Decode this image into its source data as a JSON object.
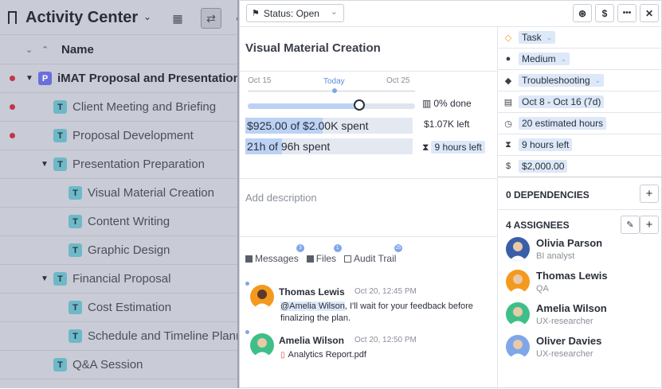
{
  "header": {
    "title": "Activity Center"
  },
  "tree": {
    "column_name": "Name",
    "rows": [
      {
        "badge": "P",
        "label": "iMAT Proposal and Presentation",
        "bold": true,
        "flag": true,
        "caret": true
      },
      {
        "badge": "T",
        "label": "Client Meeting and Briefing",
        "flag": true
      },
      {
        "badge": "T",
        "label": "Proposal Development",
        "flag": true
      },
      {
        "badge": "T",
        "label": "Presentation Preparation",
        "caret": true
      },
      {
        "badge": "T",
        "label": "Visual Material Creation"
      },
      {
        "badge": "T",
        "label": "Content Writing"
      },
      {
        "badge": "T",
        "label": "Graphic Design"
      },
      {
        "badge": "T",
        "label": "Financial Proposal",
        "caret": true
      },
      {
        "badge": "T",
        "label": "Cost Estimation"
      },
      {
        "badge": "T",
        "label": "Schedule and Timeline Planning"
      },
      {
        "badge": "T",
        "label": "Q&A Session"
      }
    ]
  },
  "panel": {
    "status_label": "Status: Open",
    "dollar_label": "$",
    "more_label": "•••",
    "close_label": "✕",
    "task_title": "Visual Material Creation",
    "timeline": {
      "start": "Oct 15",
      "today": "Today",
      "end": "Oct 25"
    },
    "progress_percent": 0,
    "progress_label": "0% done",
    "cost_spent": "$925.00 of $2.00K spent",
    "cost_left": "$1.07K left",
    "cost_fraction": 0.46,
    "hours_spent": "21h of 96h spent",
    "hours_left": "9 hours left",
    "hours_fraction": 0.22,
    "description_placeholder": "Add description",
    "tabs": [
      {
        "label": "Messages",
        "count": "3",
        "checked": true
      },
      {
        "label": "Files",
        "count": "1",
        "checked": true
      },
      {
        "label": "Audit Trail",
        "count": "25",
        "checked": false
      }
    ],
    "messages": [
      {
        "author": "Thomas Lewis",
        "time": "Oct 20, 12:45 PM",
        "mention": "@Amelia Wilson",
        "text": ", I'll wait for your feedback before finalizing the plan."
      },
      {
        "author": "Amelia Wilson",
        "time": "Oct 20, 12:50 PM",
        "attachment": "Analytics Report.pdf"
      }
    ]
  },
  "properties": {
    "type": "Task",
    "priority": "Medium",
    "category": "Troubleshooting",
    "dates": "Oct 8 - Oct 16 (7d)",
    "estimated": "20 estimated hours",
    "remaining": "9 hours left",
    "budget": "$2,000.00"
  },
  "dependencies": {
    "label": "0 DEPENDENCIES"
  },
  "assignees": {
    "label": "4 ASSIGNEES",
    "list": [
      {
        "name": "Olivia Parson",
        "role": "BI analyst",
        "color": "#3a5fa8"
      },
      {
        "name": "Thomas Lewis",
        "role": "QA",
        "color": "#f39a1e"
      },
      {
        "name": "Amelia Wilson",
        "role": "UX-researcher",
        "color": "#3fbf88"
      },
      {
        "name": "Oliver Davies",
        "role": "UX-researcher",
        "color": "#7fa7e8"
      }
    ]
  }
}
